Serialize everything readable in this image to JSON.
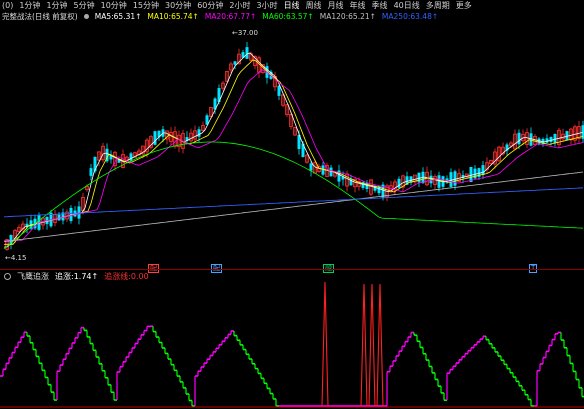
{
  "toolbar": {
    "items": [
      "1分钟",
      "1分钟",
      "5分钟",
      "10分钟",
      "15分钟",
      "30分钟",
      "60分钟",
      "2小时",
      "3小时",
      "日线",
      "周线",
      "月线",
      "年线",
      "季线",
      "40日线",
      "多周期",
      "更多"
    ],
    "active_index": 9,
    "prefix": "(0)"
  },
  "main_header": {
    "title": "完整战法(日线 前复权)",
    "ma": [
      {
        "label": "MA5:",
        "value": "65.31",
        "arrow": "↑",
        "color": "#ffffff"
      },
      {
        "label": "MA10:",
        "value": "65.74",
        "arrow": "↑",
        "color": "#ffff00"
      },
      {
        "label": "MA20:",
        "value": "67.77",
        "arrow": "↑",
        "color": "#ff00ff"
      },
      {
        "label": "MA60:",
        "value": "63.57",
        "arrow": "↑",
        "color": "#00ff00"
      },
      {
        "label": "MA120:",
        "value": "65.21",
        "arrow": "↑",
        "color": "#c0c0c0"
      },
      {
        "label": "MA250:",
        "value": "63.48",
        "arrow": "↑",
        "color": "#3060ff"
      }
    ]
  },
  "price_labels": {
    "high": "37.00",
    "low": "4.15"
  },
  "event_markers": [
    {
      "text": "配",
      "color": "#ff4040"
    },
    {
      "text": "配",
      "color": "#4aa3ff"
    },
    {
      "text": "融",
      "color": "#00cc66"
    },
    {
      "text": "T",
      "color": "#4aa3ff"
    }
  ],
  "sub_header": {
    "title": "飞鹰追涨",
    "items": [
      {
        "label": "追涨:",
        "value": "1.74",
        "arrow": "↑",
        "color": "#ffffff"
      },
      {
        "label": "追涨线:",
        "value": "0.00",
        "color": "#ff3030"
      }
    ]
  },
  "colors": {
    "up": "#ff3030",
    "down": "#00e5ff",
    "ma5": "#ffffff",
    "ma10": "#ffff00",
    "ma20": "#ff00ff",
    "ma60": "#00ff00",
    "ma120": "#c0c0c0",
    "ma250": "#3060ff",
    "osc_pos": "#ff00ff",
    "osc_neg": "#00ff00",
    "spike": "#ff2020"
  }
}
